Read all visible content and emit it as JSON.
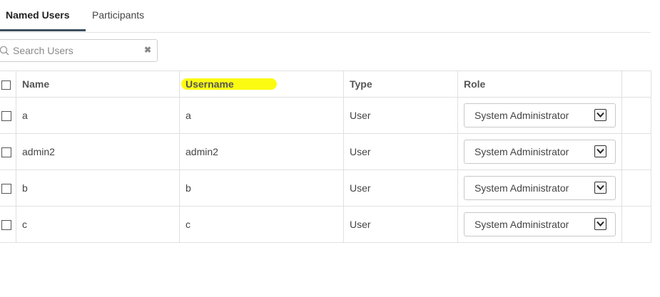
{
  "tabs": [
    {
      "label": "Named Users",
      "active": true
    },
    {
      "label": "Participants",
      "active": false
    }
  ],
  "search": {
    "placeholder": "Search Users",
    "value": "",
    "icon": "search-icon",
    "clear_icon": "close-icon"
  },
  "table": {
    "headers": {
      "name": "Name",
      "username": "Username",
      "type": "Type",
      "role": "Role"
    },
    "rows": [
      {
        "name": "a",
        "username": "a",
        "type": "User",
        "role": "System Administrator"
      },
      {
        "name": "admin2",
        "username": "admin2",
        "type": "User",
        "role": "System Administrator"
      },
      {
        "name": "b",
        "username": "b",
        "type": "User",
        "role": "System Administrator"
      },
      {
        "name": "c",
        "username": "c",
        "type": "User",
        "role": "System Administrator"
      }
    ]
  },
  "colors": {
    "highlight": "#ffff00",
    "active_tab_underline": "#3e4f5c",
    "border": "#e0e0e0"
  }
}
